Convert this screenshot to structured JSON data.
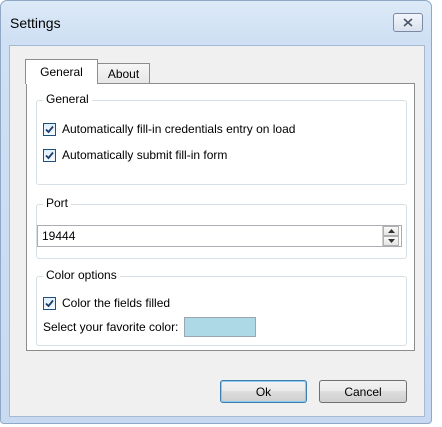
{
  "window": {
    "title": "Settings"
  },
  "tabs": [
    {
      "label": "General",
      "active": true
    },
    {
      "label": "About",
      "active": false
    }
  ],
  "general_group": {
    "title": "General",
    "options": [
      {
        "label": "Automatically fill-in credentials entry on load",
        "checked": true
      },
      {
        "label": "Automatically submit fill-in form",
        "checked": true
      }
    ]
  },
  "port_group": {
    "title": "Port",
    "value": "19444"
  },
  "color_group": {
    "title": "Color options",
    "color_fields_label": "Color the fields filled",
    "color_fields_checked": true,
    "favorite_color_label": "Select your favorite color:",
    "favorite_color": "#add8e6"
  },
  "buttons": {
    "ok_label": "Ok",
    "cancel_label": "Cancel"
  }
}
